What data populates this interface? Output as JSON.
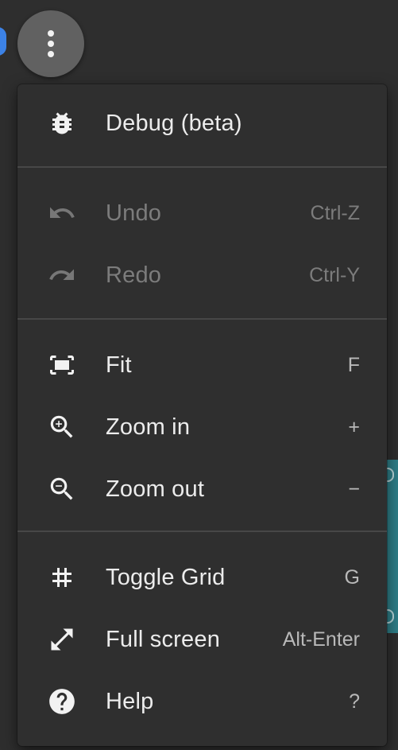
{
  "menu": {
    "items": [
      {
        "label": "Debug (beta)",
        "shortcut": "",
        "icon": "bug-icon",
        "enabled": true
      },
      {
        "label": "Undo",
        "shortcut": "Ctrl-Z",
        "icon": "undo-icon",
        "enabled": false
      },
      {
        "label": "Redo",
        "shortcut": "Ctrl-Y",
        "icon": "redo-icon",
        "enabled": false
      },
      {
        "label": "Fit",
        "shortcut": "F",
        "icon": "fit-screen-icon",
        "enabled": true
      },
      {
        "label": "Zoom in",
        "shortcut": "+",
        "icon": "zoom-in-icon",
        "enabled": true
      },
      {
        "label": "Zoom out",
        "shortcut": "−",
        "icon": "zoom-out-icon",
        "enabled": true
      },
      {
        "label": "Toggle Grid",
        "shortcut": "G",
        "icon": "grid-icon",
        "enabled": true
      },
      {
        "label": "Full screen",
        "shortcut": "Alt-Enter",
        "icon": "fullscreen-icon",
        "enabled": true
      },
      {
        "label": "Help",
        "shortcut": "?",
        "icon": "help-icon",
        "enabled": true
      }
    ]
  },
  "colors": {
    "menu_background": "#2f2f2f",
    "button_background": "#616161",
    "text": "#ececec",
    "disabled_text": "#7c7c7c"
  }
}
